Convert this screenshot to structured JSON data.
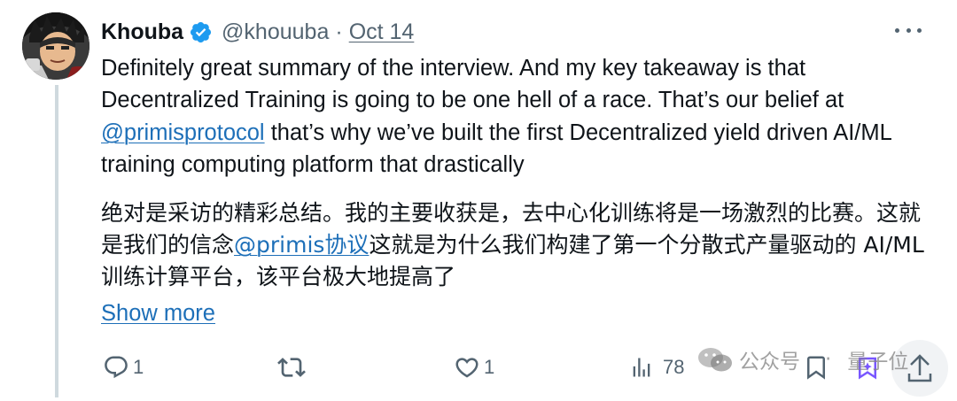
{
  "author": {
    "name": "Khouba",
    "handle": "@khouuba",
    "separator": "·",
    "date": "Oct 14"
  },
  "tweet": {
    "en_part1": "Definitely great summary of the interview. And my key takeaway is that Decentralized Training is going to be one hell of a race. That’s our belief at ",
    "en_mention": "@primisprotocol",
    "en_part2": " that’s why we’ve built the first Decentralized yield driven AI/ML training computing platform that drastically",
    "cn_part1": "绝对是采访的精彩总结。我的主要收获是，去中心化训练将是一场激烈的比赛。这就是我们的信念",
    "cn_mention": "@primis协议",
    "cn_part2": "这就是为什么我们构建了第一个分散式产量驱动的 AI/ML 训练计算平台，该平台极大地提高了",
    "show_more": "Show more"
  },
  "actions": {
    "replies": "1",
    "likes": "1",
    "views": "78"
  },
  "watermark": {
    "text1": "公众号",
    "separator": "·",
    "text2": "量子位"
  },
  "colors": {
    "text": "#0f1419",
    "secondary": "#536471",
    "link": "#1d6fb8",
    "verified": "#1d9bf0",
    "thread_line": "#cfd9de"
  }
}
